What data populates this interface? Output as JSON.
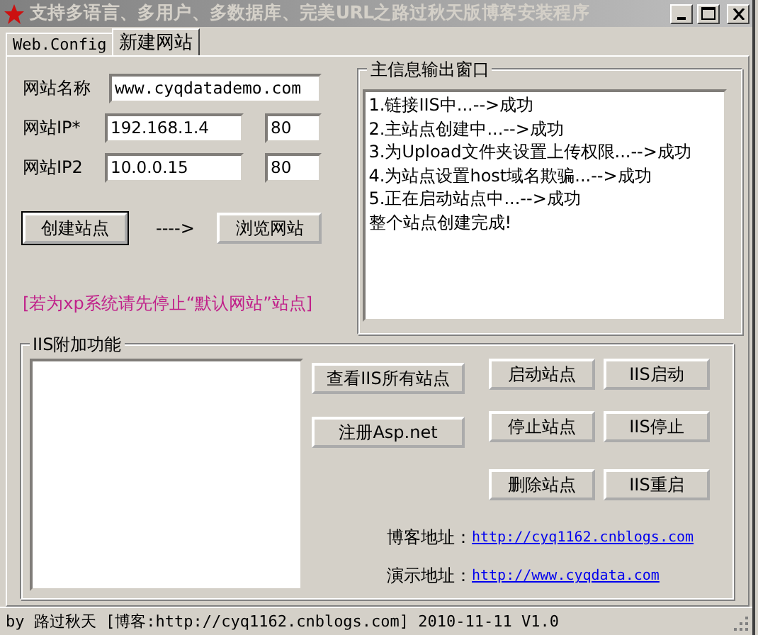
{
  "window": {
    "title": "支持多语言、多用户、多数据库、完美URL之路过秋天版博客安装程序"
  },
  "tabs": [
    {
      "label": "Web.Config",
      "selected": false
    },
    {
      "label": "新建网站",
      "selected": true
    }
  ],
  "site_form": {
    "name_field": {
      "label": "网站名称",
      "value": "www.cyqdatademo.com"
    },
    "ip_fields": [
      {
        "label": "网站IP*",
        "value": "192.168.1.4",
        "port": "80"
      },
      {
        "label": "网站IP2",
        "value": "10.0.0.15",
        "port": "80"
      }
    ],
    "create_button": "创建站点",
    "arrow": "---->",
    "browse_button": "浏览网站",
    "note": "[若为xp系统请先停止“默认网站”站点]"
  },
  "output_panel": {
    "title": "主信息输出窗口",
    "lines": [
      "1.链接IIS中...-->成功",
      "2.主站点创建中...-->成功",
      "3.为Upload文件夹设置上传权限...-->成功",
      "4.为站点设置host域名欺骗...-->成功",
      "5.正在启动站点中...-->成功",
      "整个站点创建完成!"
    ]
  },
  "iis_panel": {
    "title": "IIS附加功能",
    "left_buttons": [
      "查看IIS所有站点",
      "注册Asp.net"
    ],
    "button_rows": [
      [
        "启动站点",
        "IIS启动"
      ],
      [
        "停止站点",
        "IIS停止"
      ],
      [
        "删除站点",
        "IIS重启"
      ]
    ],
    "links": [
      {
        "label": "博客地址：",
        "url": "http://cyq1162.cnblogs.com"
      },
      {
        "label": "演示地址：",
        "url": "http://www.cyqdata.com"
      }
    ]
  },
  "status_bar": "by 路过秋天 [博客:http://cyq1162.cnblogs.com] 2010-11-11 V1.0"
}
